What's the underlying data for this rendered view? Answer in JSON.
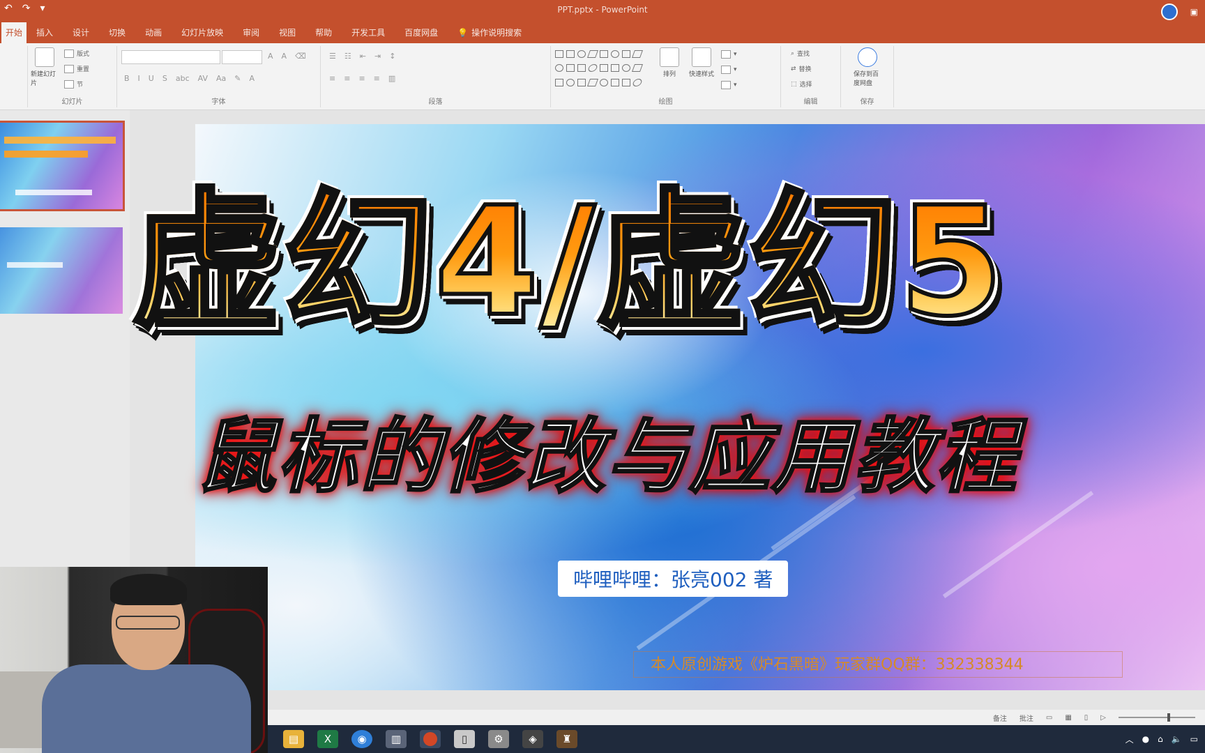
{
  "colors": {
    "accent": "#c4502d",
    "title_fill": "#ff9a10",
    "subtitle_glow": "#e00000",
    "byline_text": "#1f5fbf"
  },
  "window": {
    "title": "PPT.pptx - PowerPoint"
  },
  "ribbon": {
    "tabs": [
      {
        "label": "开始",
        "active": true
      },
      {
        "label": "插入"
      },
      {
        "label": "设计"
      },
      {
        "label": "切换"
      },
      {
        "label": "动画"
      },
      {
        "label": "幻灯片放映"
      },
      {
        "label": "审阅"
      },
      {
        "label": "视图"
      },
      {
        "label": "帮助"
      },
      {
        "label": "开发工具"
      },
      {
        "label": "百度网盘"
      }
    ],
    "tell_me": "操作说明搜索",
    "groups": {
      "slides_label": "幻灯片",
      "font_label": "字体",
      "paragraph_label": "段落",
      "drawing_label": "绘图",
      "editing_label": "编辑",
      "save_label": "保存"
    },
    "buttons": {
      "new_slide": "新建幻灯片",
      "layout": "版式",
      "reset": "重置",
      "section": "节",
      "arrange": "排列",
      "quick_styles": "快速样式",
      "find": "查找",
      "replace": "替换",
      "select": "选择",
      "save_to_baidu": "保存到百度网盘"
    }
  },
  "slide": {
    "main_title": "虚幻4/虚幻5",
    "subtitle": "鼠标的修改与应用教程",
    "byline": "哔哩哔哩：张亮002 著",
    "footer_note": "本人原创游戏《炉石黑暗》玩家群QQ群：332338344"
  },
  "statusbar": {
    "notes": "备注",
    "comments": "批注"
  },
  "taskbar": {
    "icons": [
      "file-explorer-icon",
      "excel-icon",
      "browser-icon",
      "document-icon",
      "powerpoint-icon",
      "notepad-icon",
      "settings-icon",
      "app-icon",
      "game-icon"
    ]
  }
}
